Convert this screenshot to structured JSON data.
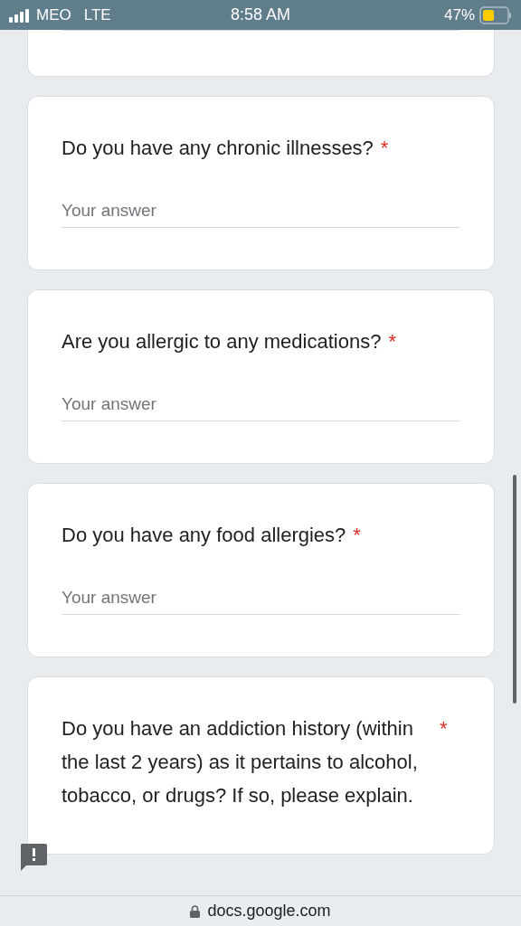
{
  "status_bar": {
    "carrier": "MEO",
    "network": "LTE",
    "time": "8:58 AM",
    "battery": "47%"
  },
  "questions": [
    {
      "text": "Do you have any chronic illnesses?",
      "required_mark": "*",
      "placeholder": "Your answer"
    },
    {
      "text": "Are you allergic to any medications?",
      "required_mark": "*",
      "placeholder": "Your answer"
    },
    {
      "text": "Do you have any food allergies?",
      "required_mark": "*",
      "placeholder": "Your answer"
    },
    {
      "text": "Do you have an addiction history (within the last 2 years) as it pertains to alcohol, tobacco, or drugs? If so, please explain.",
      "required_mark": "*"
    }
  ],
  "address_bar": {
    "url": "docs.google.com"
  }
}
